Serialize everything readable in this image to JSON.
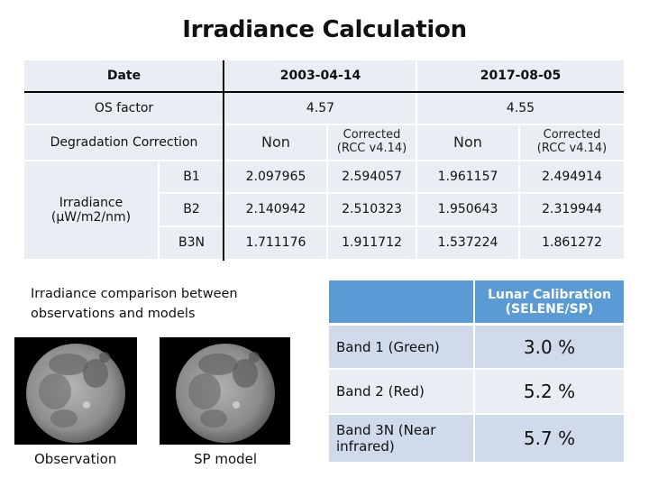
{
  "title": "Irradiance Calculation",
  "irradiance_table": {
    "header": {
      "date_label": "Date",
      "dates": [
        "2003-04-14",
        "2017-08-05"
      ]
    },
    "os_factor": {
      "label": "OS factor",
      "values": [
        "4.57",
        "4.55"
      ]
    },
    "degradation": {
      "label": "Degradation Correction",
      "columns": [
        "Non",
        "Corrected\n(RCC v4.14)",
        "Non",
        "Corrected\n(RCC v4.14)"
      ],
      "non_label": "Non",
      "corrected_line1": "Corrected",
      "corrected_line2": "(RCC v4.14)"
    },
    "irradiance_label_line1": "Irradiance",
    "irradiance_label_line2": "(μW/m2/nm)",
    "rows": [
      {
        "band": "B1",
        "values": [
          "2.097965",
          "2.594057",
          "1.961157",
          "2.494914"
        ]
      },
      {
        "band": "B2",
        "values": [
          "2.140942",
          "2.510323",
          "1.950643",
          "2.319944"
        ]
      },
      {
        "band": "B3N",
        "values": [
          "1.711176",
          "1.911712",
          "1.537224",
          "1.861272"
        ]
      }
    ]
  },
  "comparison": {
    "heading_line1": "Irradiance comparison between",
    "heading_line2": "observations and models",
    "images": [
      {
        "caption": "Observation",
        "icon": "moon-image"
      },
      {
        "caption": "SP model",
        "icon": "moon-image"
      }
    ]
  },
  "lunar_table": {
    "header_blank": "",
    "header_line1": "Lunar Calibration",
    "header_line2": "(SELENE/SP)",
    "rows": [
      {
        "band_line1": "Band 1 (Green)",
        "band_line2": "",
        "value": "3.0 %"
      },
      {
        "band_line1": "Band 2 (Red)",
        "band_line2": "",
        "value": "5.2 %"
      },
      {
        "band_line1": "Band 3N (Near",
        "band_line2": "infrared)",
        "value": "5.7 %"
      }
    ]
  },
  "colors": {
    "table_cell_bg": "#e9edf4",
    "lunar_header_bg": "#5b9bd5",
    "lunar_row_dark": "#cfdaeb",
    "lunar_row_light": "#e9edf4"
  }
}
